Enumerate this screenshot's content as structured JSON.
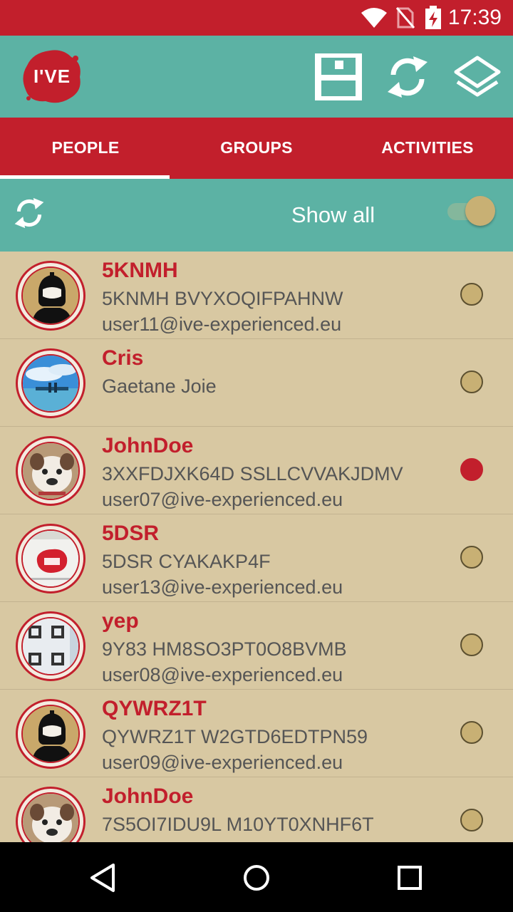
{
  "status_bar": {
    "time": "17:39",
    "icons": [
      "wifi-icon",
      "no-sim-icon",
      "battery-charging-icon"
    ]
  },
  "app_bar": {
    "logo_text": "I'VE",
    "actions": [
      "save-icon",
      "sync-icon",
      "layers-icon"
    ]
  },
  "tabs": [
    {
      "label": "PEOPLE",
      "selected": true
    },
    {
      "label": "GROUPS",
      "selected": false
    },
    {
      "label": "ACTIVITIES",
      "selected": false
    }
  ],
  "filter": {
    "label": "Show all",
    "toggle_on": true
  },
  "people": [
    {
      "name": "5KNMH",
      "line2": "5KNMH BVYXOQIFPAHNW",
      "line3": "user11@ive-experienced.eu",
      "avatar": "knight",
      "selected": false
    },
    {
      "name": "Cris",
      "line2": "Gaetane Joie",
      "line3": "",
      "avatar": "pier",
      "selected": false
    },
    {
      "name": "JohnDoe",
      "line2": "3XXFDJXK64D SSLLCVVAKJDMV",
      "line3": "user07@ive-experienced.eu",
      "avatar": "dog",
      "selected": true
    },
    {
      "name": "5DSR",
      "line2": "5DSR CYAKAKP4F",
      "line3": "user13@ive-experienced.eu",
      "avatar": "ive-card",
      "selected": false
    },
    {
      "name": "yep",
      "line2": "9Y83 HM8SO3PT0O8BVMB",
      "line3": "user08@ive-experienced.eu",
      "avatar": "qr",
      "selected": false
    },
    {
      "name": "QYWRZ1T",
      "line2": "QYWRZ1T W2GTD6EDTPN59",
      "line3": "user09@ive-experienced.eu",
      "avatar": "knight",
      "selected": false
    },
    {
      "name": "JohnDoe",
      "line2": "7S5OI7IDU9L M10YT0XNHF6T",
      "line3": "",
      "avatar": "dog",
      "selected": false
    }
  ],
  "colors": {
    "primary_red": "#c21f2c",
    "teal": "#5cb2a4",
    "list_bg": "#d8c8a2",
    "radio_fill": "#c8b074"
  },
  "nav_bar": [
    "back-icon",
    "home-icon",
    "recents-icon"
  ]
}
